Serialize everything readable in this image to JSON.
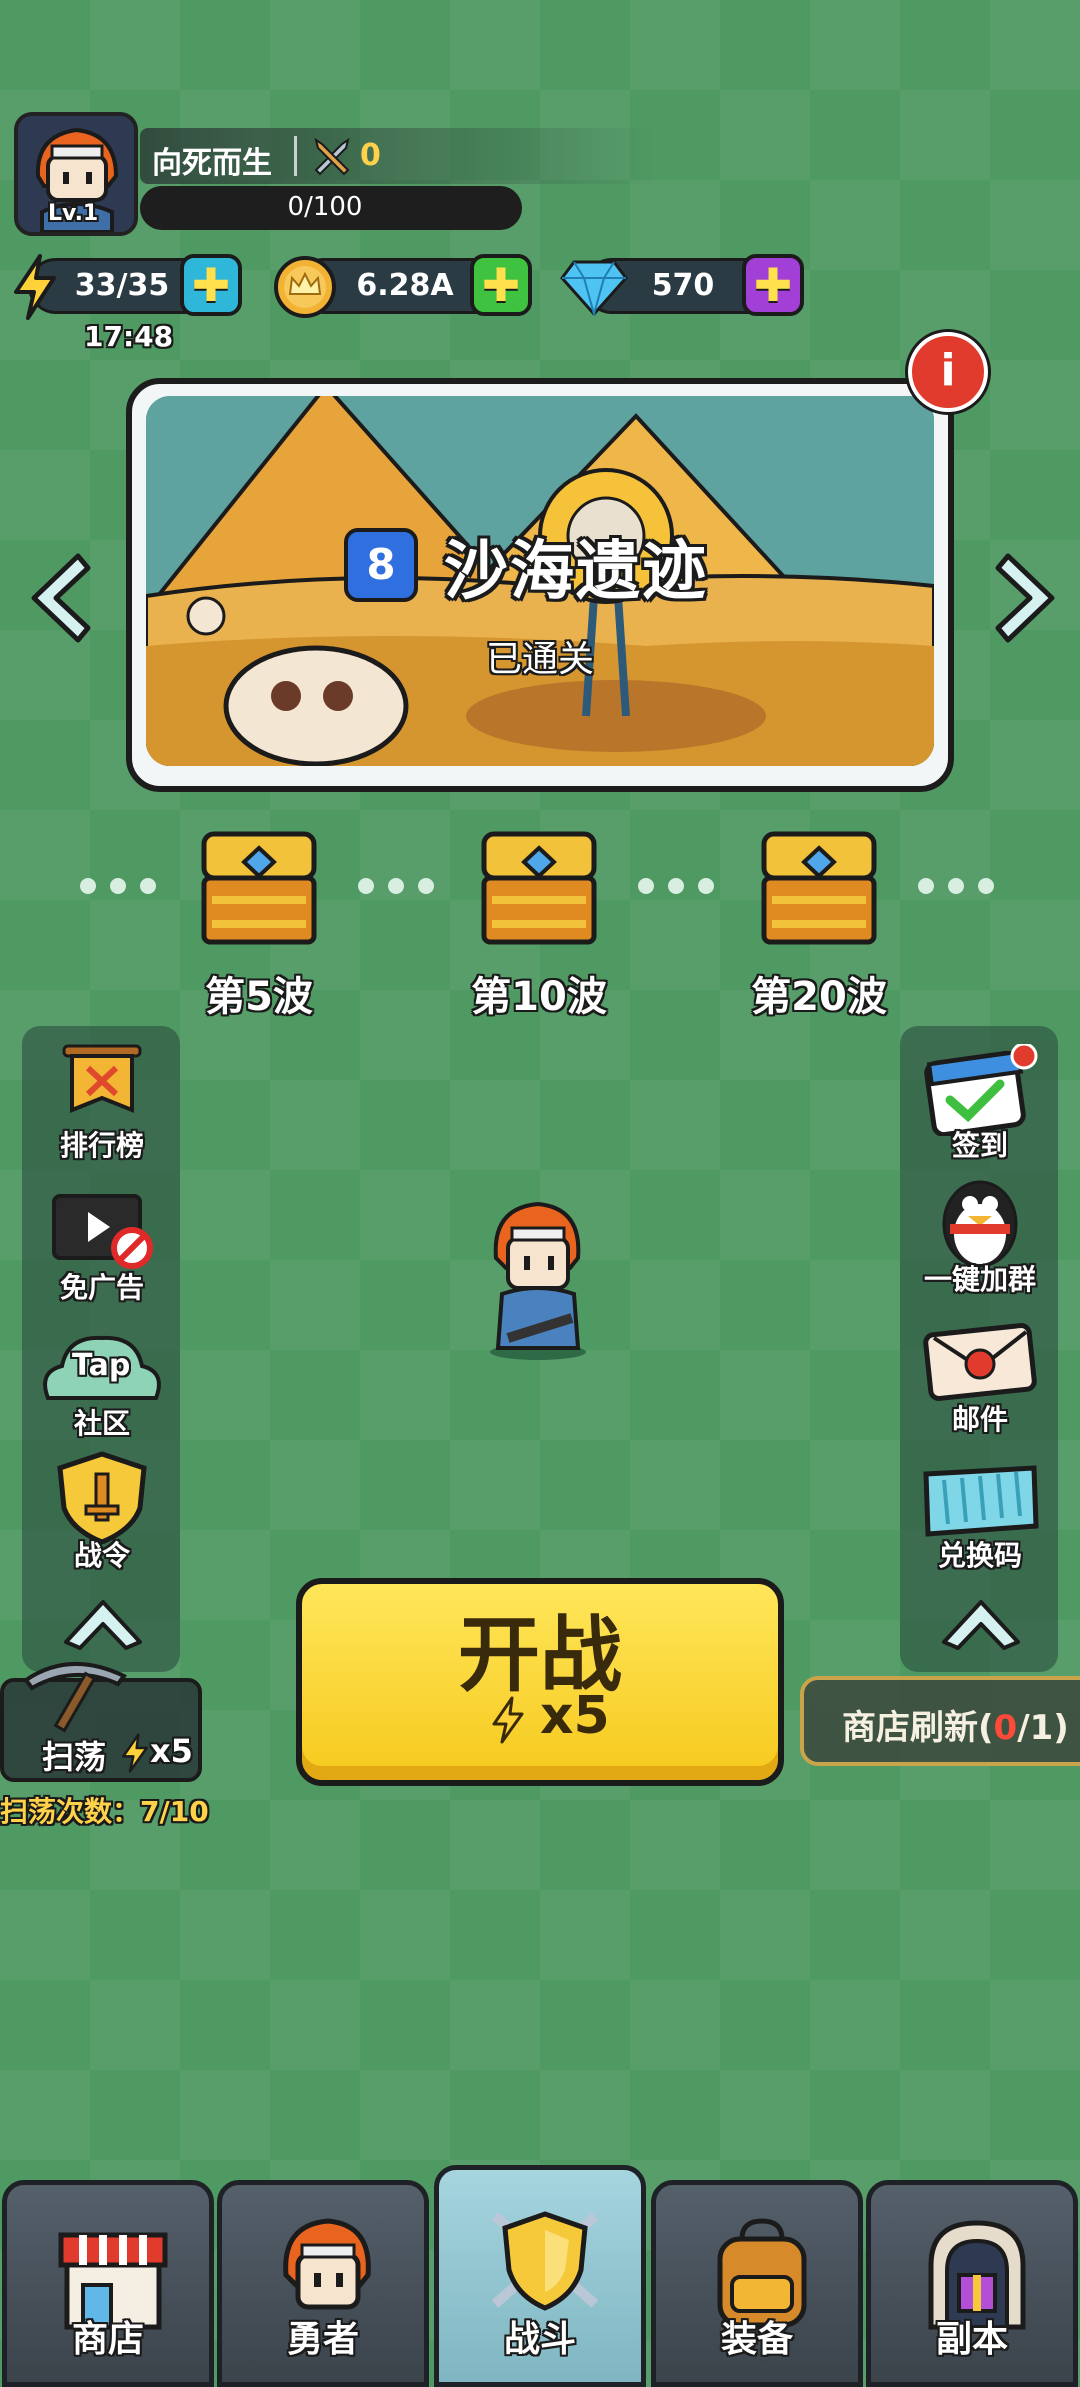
{
  "player": {
    "name": "向死而生",
    "level": "Lv.1",
    "sword_count": "0",
    "exp": "0/100"
  },
  "resources": {
    "energy": "33/35",
    "energy_timer": "17:48",
    "gold": "6.28A",
    "gems": "570"
  },
  "stage": {
    "number": "8",
    "name": "沙海遗迹",
    "status": "已通关"
  },
  "waves": [
    {
      "label": "第5波"
    },
    {
      "label": "第10波"
    },
    {
      "label": "第20波"
    }
  ],
  "left_menu": {
    "items": [
      {
        "label": "排行榜",
        "icon": "leaderboard-banner-icon"
      },
      {
        "label": "免广告",
        "icon": "no-ads-film-icon"
      },
      {
        "label": "社区",
        "icon": "taptap-community-icon",
        "badge": "Tap"
      },
      {
        "label": "战令",
        "icon": "battle-pass-shield-icon"
      }
    ]
  },
  "right_menu": {
    "items": [
      {
        "label": "签到",
        "icon": "check-in-calendar-icon"
      },
      {
        "label": "一键加群",
        "icon": "qq-penguin-icon"
      },
      {
        "label": "邮件",
        "icon": "mail-envelope-icon"
      },
      {
        "label": "兑换码",
        "icon": "redeem-code-ticket-icon"
      }
    ]
  },
  "battle": {
    "label": "开战",
    "cost": "x5"
  },
  "sweep": {
    "label": "扫荡",
    "cost": "x5",
    "count_text": "扫荡次数：7/10"
  },
  "shop_refresh": {
    "prefix": "商店刷新(",
    "current": "0",
    "suffix": "/1)"
  },
  "bottom_nav": [
    {
      "label": "商店",
      "icon": "shop-icon"
    },
    {
      "label": "勇者",
      "icon": "hero-icon"
    },
    {
      "label": "战斗",
      "icon": "battle-shield-icon",
      "active": true
    },
    {
      "label": "装备",
      "icon": "backpack-icon"
    },
    {
      "label": "副本",
      "icon": "dungeon-gate-icon"
    }
  ],
  "colors": {
    "background": "#4f9a63",
    "battle_button": "#f6c91d",
    "energy_plus": "#2fb7d9",
    "gold_plus": "#3fc23f",
    "gem_plus": "#a23fd6",
    "active_tab": "#a6d5df"
  }
}
